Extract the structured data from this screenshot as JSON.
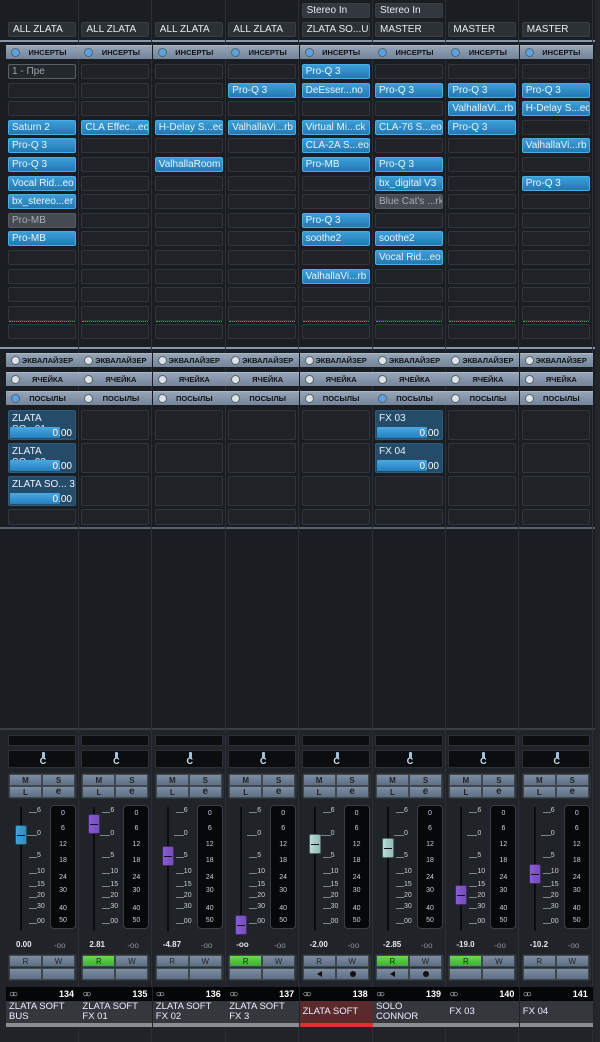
{
  "section_labels": {
    "inserts": "ИНСЕРТЫ",
    "eq": "ЭКВАЛАЙЗЕР",
    "strip": "ЯЧЕЙКА",
    "sends": "ПОСЫЛЫ"
  },
  "buttons": {
    "mute": "M",
    "solo": "S",
    "listen": "L",
    "edit": "e",
    "read": "R",
    "write": "W"
  },
  "fader_scale": [
    "6",
    "0",
    "5",
    "10",
    "15",
    "20",
    "30",
    "00"
  ],
  "meter_scale": [
    "0",
    "6",
    "12",
    "18",
    "24",
    "30",
    "40",
    "50"
  ],
  "colors": {
    "insert_active": "#2f8ac4",
    "read_on": "#4fc244",
    "selected_strip": "#e03030"
  },
  "strips": [
    {
      "input": null,
      "output": "ALL ZLATA",
      "inserts_on": true,
      "inserts": [
        {
          "slot": 1,
          "name": "1 - Пре",
          "dropdown": true
        },
        {
          "slot": 4,
          "name": "Saturn 2"
        },
        {
          "slot": 5,
          "name": "Pro-Q 3"
        },
        {
          "slot": 6,
          "name": "Pro-Q 3"
        },
        {
          "slot": 7,
          "name": "Vocal Rid...eo"
        },
        {
          "slot": 8,
          "name": "bx_stereo...er"
        },
        {
          "slot": 9,
          "name": "Pro-MB",
          "bypassed": true
        },
        {
          "slot": 10,
          "name": "Pro-MB"
        }
      ],
      "sends_on": true,
      "sends": [
        {
          "slot": 1,
          "name": "ZLATA SO...01",
          "level": "0.00"
        },
        {
          "slot": 2,
          "name": "ZLATA SO...02",
          "level": "0.00"
        },
        {
          "slot": 3,
          "name": "ZLATA SO... 3",
          "level": "0.00"
        }
      ],
      "pan": "C",
      "fader_db": 0,
      "fader_color": "#3ea6d8",
      "volume": "0.00",
      "peak": "-oo",
      "read": false,
      "monitor": false,
      "number": "134",
      "name": "ZLATA SOFT BUS",
      "selected": false
    },
    {
      "input": null,
      "output": "ALL ZLATA",
      "inserts_on": true,
      "inserts": [
        {
          "slot": 4,
          "name": "CLA Effec...eo"
        }
      ],
      "sends_on": false,
      "sends": [],
      "pan": "C",
      "fader_db": 2.81,
      "fader_color": "#8b5bd9",
      "volume": "2.81",
      "peak": "-oo",
      "read": true,
      "monitor": false,
      "number": "135",
      "name": "ZLATA SOFT FX 01",
      "selected": false
    },
    {
      "input": null,
      "output": "ALL ZLATA",
      "inserts_on": true,
      "inserts": [
        {
          "slot": 4,
          "name": "H-Delay S...eo"
        },
        {
          "slot": 6,
          "name": "ValhallaRoom"
        }
      ],
      "sends_on": false,
      "sends": [],
      "pan": "C",
      "fader_db": -4.87,
      "fader_color": "#8b5bd9",
      "volume": "-4.87",
      "peak": "-oo",
      "read": false,
      "monitor": false,
      "number": "136",
      "name": "ZLATA SOFT FX 02",
      "selected": false
    },
    {
      "input": null,
      "output": "ALL ZLATA",
      "inserts_on": true,
      "inserts": [
        {
          "slot": 2,
          "name": "Pro-Q 3"
        },
        {
          "slot": 4,
          "name": "ValhallaVi...rb"
        }
      ],
      "sends_on": false,
      "sends": [],
      "pan": "C",
      "fader_db": -100,
      "fader_color": "#8b5bd9",
      "volume": "-oo",
      "peak": "-oo",
      "read": true,
      "monitor": false,
      "number": "137",
      "name": "ZLATA SOFT FX 3",
      "selected": false
    },
    {
      "input": "Stereo In",
      "output": "ZLATA SO...US",
      "inserts_on": true,
      "inserts": [
        {
          "slot": 1,
          "name": "Pro-Q 3"
        },
        {
          "slot": 2,
          "name": "DeEsser...no"
        },
        {
          "slot": 4,
          "name": "Virtual Mi...ck"
        },
        {
          "slot": 5,
          "name": "CLA-2A S...eo"
        },
        {
          "slot": 6,
          "name": "Pro-MB"
        },
        {
          "slot": 9,
          "name": "Pro-Q 3"
        },
        {
          "slot": 10,
          "name": "soothe2"
        },
        {
          "slot": 12,
          "name": "ValhallaVi...rb"
        }
      ],
      "sends_on": false,
      "sends": [],
      "pan": "C",
      "fader_db": -2.0,
      "fader_color": "#b5e0da",
      "volume": "-2.00",
      "peak": "-oo",
      "read": false,
      "monitor": true,
      "number": "138",
      "name": "ZLATA SOFT",
      "selected": true
    },
    {
      "input": "Stereo In",
      "output": "MASTER",
      "inserts_on": true,
      "inserts": [
        {
          "slot": 2,
          "name": "Pro-Q 3"
        },
        {
          "slot": 4,
          "name": "CLA-76 S...eo"
        },
        {
          "slot": 6,
          "name": "Pro-Q 3"
        },
        {
          "slot": 7,
          "name": "bx_digital V3"
        },
        {
          "slot": 8,
          "name": "Blue Cat's ...rk",
          "bypassed": true
        },
        {
          "slot": 10,
          "name": "soothe2"
        },
        {
          "slot": 11,
          "name": "Vocal Rid...eo"
        }
      ],
      "sends_on": true,
      "sends": [
        {
          "slot": 1,
          "name": "FX 03",
          "level": "0.00"
        },
        {
          "slot": 2,
          "name": "FX 04",
          "level": "0.00"
        }
      ],
      "pan": "C",
      "fader_db": -2.85,
      "fader_color": "#b5e0da",
      "volume": "-2.85",
      "peak": "-oo",
      "read": true,
      "monitor": true,
      "number": "139",
      "name": "SOLO CONNOR",
      "selected": false
    },
    {
      "input": null,
      "output": "MASTER",
      "inserts_on": true,
      "inserts": [
        {
          "slot": 2,
          "name": "Pro-Q 3"
        },
        {
          "slot": 3,
          "name": "ValhallaVi...rb"
        },
        {
          "slot": 4,
          "name": "Pro-Q 3"
        }
      ],
      "sends_on": false,
      "sends": [],
      "pan": "C",
      "fader_db": -19.0,
      "fader_color": "#8b5bd9",
      "volume": "-19.0",
      "peak": "-oo",
      "read": true,
      "monitor": false,
      "number": "140",
      "name": "FX 03",
      "selected": false
    },
    {
      "input": null,
      "output": "MASTER",
      "inserts_on": true,
      "inserts": [
        {
          "slot": 2,
          "name": "Pro-Q 3"
        },
        {
          "slot": 3,
          "name": "H-Delay S...eo"
        },
        {
          "slot": 5,
          "name": "ValhallaVi...rb"
        },
        {
          "slot": 7,
          "name": "Pro-Q 3"
        }
      ],
      "sends_on": false,
      "sends": [],
      "pan": "C",
      "fader_db": -10.2,
      "fader_color": "#8b5bd9",
      "volume": "-10.2",
      "peak": "-oo",
      "read": false,
      "monitor": false,
      "number": "141",
      "name": "FX 04",
      "selected": false
    }
  ]
}
